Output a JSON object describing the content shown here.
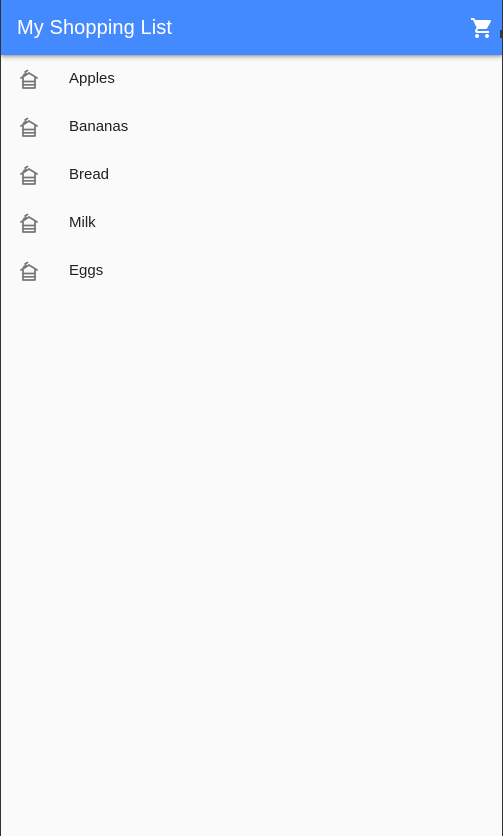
{
  "app_bar": {
    "title": "My Shopping List",
    "background_color": "#448aff",
    "action_icon": "shopping-cart-icon"
  },
  "items": [
    {
      "label": "Apples",
      "icon": "grocery-store-icon"
    },
    {
      "label": "Bananas",
      "icon": "grocery-store-icon"
    },
    {
      "label": "Bread",
      "icon": "grocery-store-icon"
    },
    {
      "label": "Milk",
      "icon": "grocery-store-icon"
    },
    {
      "label": "Eggs",
      "icon": "grocery-store-icon"
    }
  ]
}
